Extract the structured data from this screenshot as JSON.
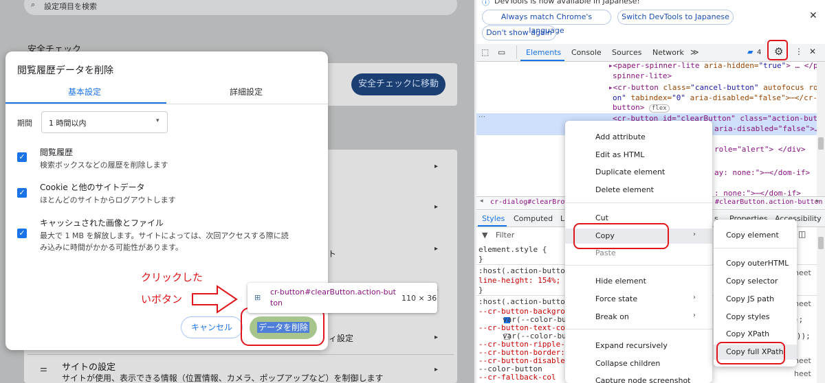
{
  "settings": {
    "search_placeholder": "設定項目を検索",
    "safety_title": "安全チェック",
    "safety_button": "安全チェックに移動",
    "partial_row_text1": "ト",
    "partial_row_text2": "ィ設定",
    "site_settings_title": "サイトの設定",
    "site_settings_desc": "サイトが使用、表示できる情報（位置情報、カメラ、ポップアップなど）を制御します"
  },
  "dialog": {
    "title": "閲覧履歴データを削除",
    "tabs": [
      "基本設定",
      "詳細設定"
    ],
    "period_label": "期間",
    "period_value": "1 時間以内",
    "items": [
      {
        "title": "閲覧履歴",
        "desc": "検索ボックスなどの履歴を削除します",
        "checked": true
      },
      {
        "title": "Cookie と他のサイトデータ",
        "desc": "ほとんどのサイトからログアウトします",
        "checked": true
      },
      {
        "title": "キャッシュされた画像とファイル",
        "desc": "最大で 1 MB を解放します。サイトによっては、次回アクセスする際に読",
        "desc2": "み込みに時間がかかる可能性があります。",
        "checked": true
      }
    ],
    "cancel": "キャンセル",
    "delete": "データを削除"
  },
  "annotation": {
    "line1": "クリックした",
    "line2": "いボタン"
  },
  "tooltip": {
    "selector": "cr-button#clearButton.action-but",
    "selector2": "ton",
    "size": "110 × 36"
  },
  "devtools": {
    "info_text": "DevTools is now available in Japanese!",
    "btn_match": "Always match Chrome's language",
    "btn_switch": "Switch DevTools to Japanese",
    "btn_dont": "Don't show again",
    "tabs": [
      "Elements",
      "Console",
      "Sources",
      "Network"
    ],
    "more_tabs": "≫",
    "issues_count": "4",
    "code": [
      {
        "indent": 0,
        "text_tag": "▸<paper-spinner-lite",
        "text_attr": " aria-hidden=",
        "text_val": "\"true\"",
        "text_rest": "> … </paper-"
      },
      {
        "indent": 0,
        "text_tag": "spinner-lite>",
        "text_attr": "",
        "text_val": "",
        "text_rest": ""
      },
      {
        "indent": 0,
        "text_tag": "▸<cr-button",
        "text_attr": " class=",
        "text_val": "\"cancel-button\"",
        "text_rest": " autofocus role=\"butt"
      },
      {
        "indent": 0,
        "text_tag": "on\"",
        "text_attr": " tabindex=",
        "text_val": "\"0\"",
        "text_rest": " aria-disabled=\"false\">⋯</cr-"
      },
      {
        "indent": 0,
        "text_tag": "button>",
        "text_attr": "",
        "text_val": "",
        "text_rest": "flex"
      }
    ],
    "selected_line": "<cr-button id=\"clearButton\" class=\"action-button\"",
    "selected_line2": "aria-disabled=\"false\">…",
    "code_after": [
      " role=\"alert\"> </div>",
      "ay: none:\">⋯</dom-if>",
      ": none:\">⋯</dom-if>"
    ],
    "breadcrumb_left": "cr-dialog#clearBrowsin",
    "breadcrumb_right": "#clearButton.action-button",
    "style_tabs": [
      "Styles",
      "Computed",
      "L"
    ],
    "style_tabs_right": [
      "s",
      "Properties",
      "Accessibility"
    ],
    "filter_placeholder": "Filter",
    "styles": [
      "element.style {",
      "}",
      ":host(.action-button),",
      "   line-height: 154%;",
      "}",
      ":host(.action-button) {",
      "   --cr-button-backgrou",
      "     var(--color-bu",
      "   --cr-button-text-col",
      "     var(--color-bu",
      "   --cr-button-ripple-c",
      "   --cr-button-border:",
      "   --cr-button-disabled",
      "       --color-button",
      "   --cr-fallback-col"
    ],
    "styles_right": [
      "heet",
      "heet",
      ");",
      "ary));",
      "heet",
      "heet"
    ],
    "context_menu": [
      "Add attribute",
      "Edit as HTML",
      "Duplicate element",
      "Delete element",
      "Cut",
      "Copy",
      "Paste",
      "Hide element",
      "Force state",
      "Break on",
      "Expand recursively",
      "Collapse children",
      "Capture node screenshot"
    ],
    "copy_submenu": [
      "Copy element",
      "Copy outerHTML",
      "Copy selector",
      "Copy JS path",
      "Copy styles",
      "Copy XPath",
      "Copy full XPath"
    ]
  }
}
